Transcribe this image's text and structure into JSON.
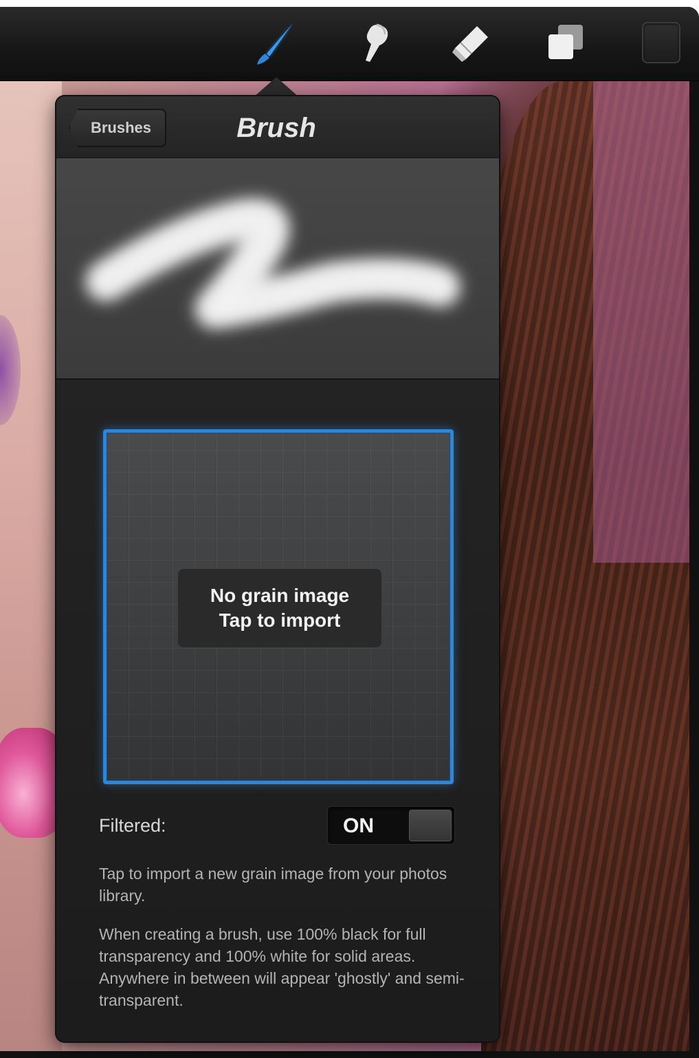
{
  "toolbar": {
    "tools": [
      {
        "icon": "brush-icon",
        "active": true
      },
      {
        "icon": "smudge-icon",
        "active": false
      },
      {
        "icon": "eraser-icon",
        "active": false
      },
      {
        "icon": "layers-icon",
        "active": false
      },
      {
        "icon": "color-swatch",
        "active": false
      }
    ],
    "accent_color": "#2f86d6"
  },
  "popover": {
    "back_label": "Brushes",
    "title": "Brush",
    "grain": {
      "line1": "No grain image",
      "line2": "Tap to import"
    },
    "filtered": {
      "label": "Filtered:",
      "state": "ON"
    },
    "help": [
      "Tap to import a new grain image from your photos library.",
      "When creating a brush, use 100% black for full transparency and 100% white for solid areas. Anywhere in between will appear 'ghostly' and semi-transparent."
    ]
  }
}
